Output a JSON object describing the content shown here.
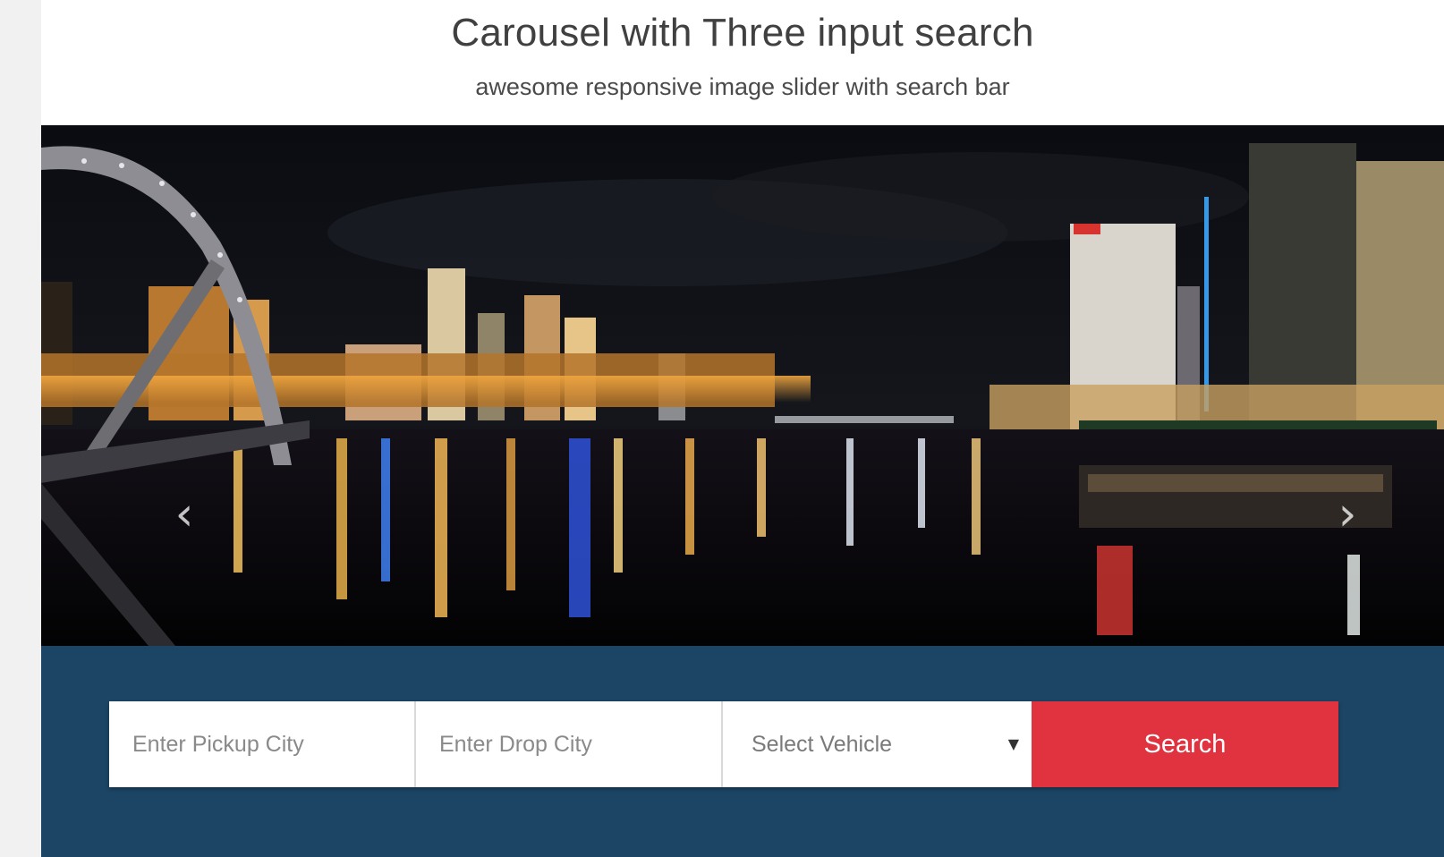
{
  "header": {
    "title": "Carousel with Three input search",
    "subtitle": "awesome responsive image slider with search bar"
  },
  "carousel": {
    "slide_description_icon": "night-city-river-skyline",
    "prev_glyph": "‹",
    "next_glyph": "›"
  },
  "search": {
    "pickup_placeholder": "Enter Pickup City",
    "drop_placeholder": "Enter Drop City",
    "vehicle_selected": "Select Vehicle",
    "button_label": "Search"
  },
  "colors": {
    "search_bar_bg": "#1c4565",
    "search_button": "#e0323f",
    "page_bg": "#f1f1f1"
  }
}
